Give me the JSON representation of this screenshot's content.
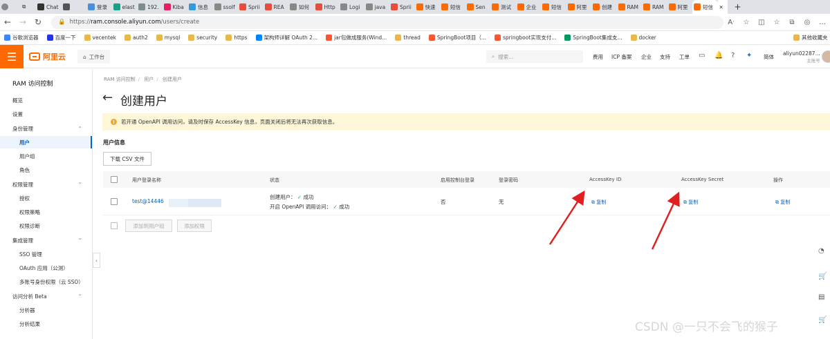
{
  "browser": {
    "tabs": [
      {
        "label": "Chat",
        "color": "#333"
      },
      {
        "label": "",
        "color": "#555"
      },
      {
        "label": "登录",
        "color": "#4a90d9"
      },
      {
        "label": "elast",
        "color": "#16a085"
      },
      {
        "label": "192.",
        "color": "#7f8c8d"
      },
      {
        "label": "Kiba",
        "color": "#e91e63"
      },
      {
        "label": "信息",
        "color": "#3498db"
      },
      {
        "label": "ssoIf",
        "color": "#888"
      },
      {
        "label": "Sprii",
        "color": "#e74c3c"
      },
      {
        "label": "REA",
        "color": "#e74c3c"
      },
      {
        "label": "如何",
        "color": "#888"
      },
      {
        "label": "Http",
        "color": "#e74c3c"
      },
      {
        "label": "Logi",
        "color": "#888"
      },
      {
        "label": "java",
        "color": "#888"
      },
      {
        "label": "Sprii",
        "color": "#e74c3c"
      },
      {
        "label": "快速",
        "color": "#ff6a00"
      },
      {
        "label": "短信",
        "color": "#ff6a00"
      },
      {
        "label": "Sen",
        "color": "#ff6a00"
      },
      {
        "label": "测试",
        "color": "#ff6a00"
      },
      {
        "label": "企业",
        "color": "#ff6a00"
      },
      {
        "label": "短信",
        "color": "#ff6a00"
      },
      {
        "label": "阿里",
        "color": "#ff6a00"
      },
      {
        "label": "创建",
        "color": "#ff6a00"
      },
      {
        "label": "RAM",
        "color": "#ff6a00"
      },
      {
        "label": "RAM",
        "color": "#ff6a00"
      },
      {
        "label": "阿里",
        "color": "#ff6a00"
      },
      {
        "label": "短信",
        "color": "#ff6a00"
      }
    ],
    "active_tab_close": "✕",
    "new_tab": "+",
    "url_prefix": "https://",
    "url_host": "ram.console.aliyun.com",
    "url_path": "/users/create",
    "bookmarks": [
      {
        "label": "谷歌浏览器",
        "icon": "google-icon"
      },
      {
        "label": "百度一下",
        "icon": "baidu-icon"
      },
      {
        "label": "vecentek",
        "icon": "folder-icon"
      },
      {
        "label": "auth2",
        "icon": "folder-icon"
      },
      {
        "label": "mysql",
        "icon": "folder-icon"
      },
      {
        "label": "security",
        "icon": "folder-icon"
      },
      {
        "label": "https",
        "icon": "folder-icon"
      },
      {
        "label": "架构师详解 OAuth 2...",
        "icon": "zhihu-icon"
      },
      {
        "label": "jar包做成服务(Wind...",
        "icon": "csdn-icon"
      },
      {
        "label": "thread",
        "icon": "folder-icon"
      },
      {
        "label": "SpringBoot项目（...",
        "icon": "csdn-icon"
      },
      {
        "label": "springboot实现支付...",
        "icon": "csdn-icon"
      },
      {
        "label": "SpringBoot集成支...",
        "icon": "sf-icon"
      },
      {
        "label": "docker",
        "icon": "folder-icon"
      }
    ],
    "other_bookmarks": "其他收藏夹"
  },
  "console": {
    "brand": "阿里云",
    "workbench": "工作台",
    "search_placeholder": "搜索...",
    "links": [
      "费用",
      "ICP 备案",
      "企业",
      "支持",
      "工单"
    ],
    "lang": "简体",
    "account_name": "aliyun02287...",
    "account_role": "主账号"
  },
  "sidebar": {
    "title": "RAM 访问控制",
    "items": [
      {
        "label": "概览",
        "level": 1
      },
      {
        "label": "设置",
        "level": 1
      },
      {
        "label": "身份管理",
        "level": 1,
        "group": true
      },
      {
        "label": "用户",
        "level": 2,
        "active": true
      },
      {
        "label": "用户组",
        "level": 2
      },
      {
        "label": "角色",
        "level": 2
      },
      {
        "label": "权限管理",
        "level": 1,
        "group": true
      },
      {
        "label": "授权",
        "level": 2
      },
      {
        "label": "权限策略",
        "level": 2
      },
      {
        "label": "权限诊断",
        "level": 2
      },
      {
        "label": "集成管理",
        "level": 1,
        "group": true
      },
      {
        "label": "SSO 管理",
        "level": 2
      },
      {
        "label": "OAuth 应用（公测）",
        "level": 2
      },
      {
        "label": "多账号身份权限（云 SSO）",
        "level": 2
      },
      {
        "label": "访问分析 Beta",
        "level": 1,
        "group": true
      },
      {
        "label": "分析器",
        "level": 2
      },
      {
        "label": "分析结果",
        "level": 2
      }
    ]
  },
  "main": {
    "breadcrumb": [
      "RAM 访问控制",
      "用户",
      "创建用户"
    ],
    "title": "创建用户",
    "notice": "若开通 OpenAPI 调用访问，请及时保存 AccessKey 信息，页面关闭后将无法再次获取信息。",
    "section_title": "用户信息",
    "csv_button": "下载 CSV 文件",
    "columns": [
      "用户登录名称",
      "状态",
      "启用控制台登录",
      "登录密码",
      "AccessKey ID",
      "AccessKey Secret",
      "操作"
    ],
    "row": {
      "login_name": "test@14446",
      "status_line1_label": "创建用户：",
      "status_line1_value": "成功",
      "status_line2_label": "开启 OpenAPI 调用访问：",
      "status_line2_value": "成功",
      "console_login": "否",
      "password": "无",
      "copy": "复制"
    },
    "add_to_group": "添加到用户组",
    "add_permission": "添加权限"
  },
  "watermark": "CSDN @一只不会飞的猴子"
}
